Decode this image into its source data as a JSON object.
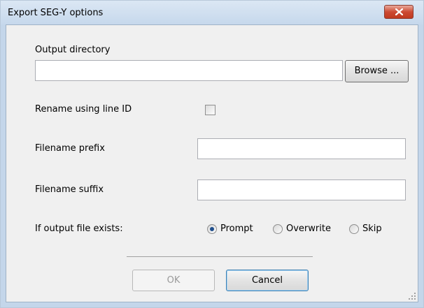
{
  "window": {
    "title": "Export SEG-Y options"
  },
  "output_directory": {
    "label": "Output directory",
    "value": "",
    "browse_label": "Browse ..."
  },
  "rename": {
    "label": "Rename using line ID",
    "checked": false
  },
  "prefix": {
    "label": "Filename prefix",
    "value": ""
  },
  "suffix": {
    "label": "Filename suffix",
    "value": ""
  },
  "exists": {
    "label": "If output file exists:",
    "options": [
      "Prompt",
      "Overwrite",
      "Skip"
    ],
    "selected": "Prompt"
  },
  "buttons": {
    "ok": "OK",
    "cancel": "Cancel"
  },
  "icons": {
    "close": "close-icon",
    "resize": "resize-grip-icon"
  }
}
